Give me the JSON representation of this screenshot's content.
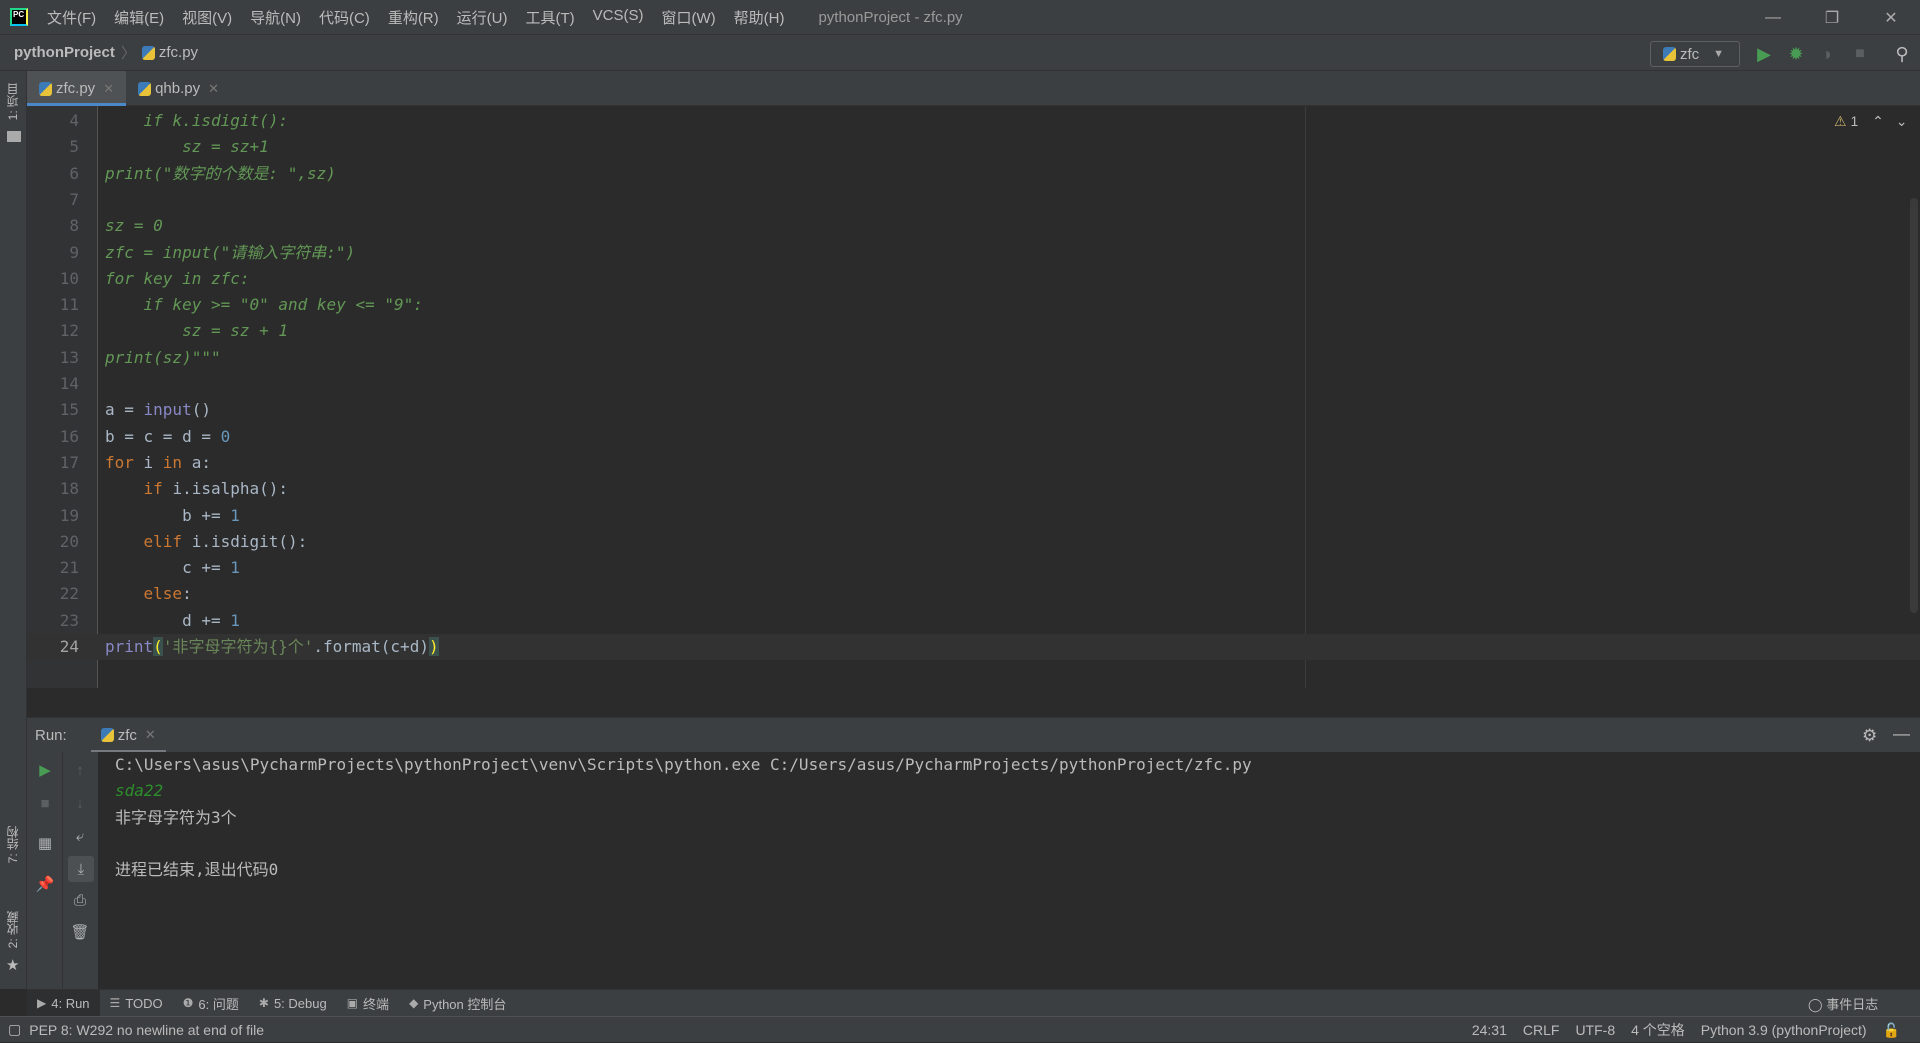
{
  "menu": {
    "items": [
      "文件(F)",
      "编辑(E)",
      "视图(V)",
      "导航(N)",
      "代码(C)",
      "重构(R)",
      "运行(U)",
      "工具(T)",
      "VCS(S)",
      "窗口(W)",
      "帮助(H)"
    ],
    "title": "pythonProject - zfc.py",
    "logo": "PC"
  },
  "nav": {
    "project": "pythonProject",
    "file": "zfc.py",
    "run_config": "zfc"
  },
  "left_strip": {
    "project": "1: 项目",
    "structure": "7: 结构",
    "favorites": "2: 收藏"
  },
  "tabs": [
    {
      "label": "zfc.py",
      "active": true
    },
    {
      "label": "qhb.py",
      "active": false
    }
  ],
  "editor": {
    "warnings": "1",
    "current_line": 24,
    "lines": [
      {
        "n": "4",
        "t": [
          [
            "doc",
            "    if k.isdigit():"
          ]
        ]
      },
      {
        "n": "5",
        "t": [
          [
            "doc",
            "        sz = sz+1"
          ]
        ]
      },
      {
        "n": "6",
        "t": [
          [
            "doc",
            "print(\"数字的个数是: \",sz)"
          ]
        ]
      },
      {
        "n": "7",
        "t": []
      },
      {
        "n": "8",
        "t": [
          [
            "doc",
            "sz = 0"
          ]
        ]
      },
      {
        "n": "9",
        "t": [
          [
            "doc",
            "zfc = input(\"请输入字符串:\")"
          ]
        ]
      },
      {
        "n": "10",
        "t": [
          [
            "doc",
            "for key in zfc:"
          ]
        ]
      },
      {
        "n": "11",
        "t": [
          [
            "doc",
            "    if key >= \"0\" and key <= \"9\":"
          ]
        ]
      },
      {
        "n": "12",
        "t": [
          [
            "doc",
            "        sz = sz + 1"
          ]
        ]
      },
      {
        "n": "13",
        "t": [
          [
            "doc",
            "print(sz)\"\"\""
          ]
        ]
      },
      {
        "n": "14",
        "t": []
      },
      {
        "n": "15",
        "t": [
          [
            "d",
            "a = "
          ],
          [
            "b",
            "input"
          ],
          [
            "d",
            "()"
          ]
        ]
      },
      {
        "n": "16",
        "t": [
          [
            "d",
            "b = c = d = "
          ],
          [
            "n",
            "0"
          ]
        ]
      },
      {
        "n": "17",
        "t": [
          [
            "k",
            "for "
          ],
          [
            "d",
            "i "
          ],
          [
            "k",
            "in "
          ],
          [
            "d",
            "a:"
          ]
        ]
      },
      {
        "n": "18",
        "t": [
          [
            "d",
            "    "
          ],
          [
            "k",
            "if "
          ],
          [
            "d",
            "i.isalpha():"
          ]
        ]
      },
      {
        "n": "19",
        "t": [
          [
            "d",
            "        b += "
          ],
          [
            "n",
            "1"
          ]
        ]
      },
      {
        "n": "20",
        "t": [
          [
            "d",
            "    "
          ],
          [
            "k",
            "elif "
          ],
          [
            "d",
            "i.isdigit():"
          ]
        ]
      },
      {
        "n": "21",
        "t": [
          [
            "d",
            "        c += "
          ],
          [
            "n",
            "1"
          ]
        ]
      },
      {
        "n": "22",
        "t": [
          [
            "d",
            "    "
          ],
          [
            "k",
            "else"
          ],
          [
            "d",
            ":"
          ]
        ]
      },
      {
        "n": "23",
        "t": [
          [
            "d",
            "        d += "
          ],
          [
            "n",
            "1"
          ]
        ]
      },
      {
        "n": "24",
        "t": [
          [
            "b",
            "print"
          ],
          [
            "br",
            "("
          ],
          [
            "s",
            "'非字母字符为{}个'"
          ],
          [
            "d",
            ".format(c+d)"
          ],
          [
            "br",
            ")"
          ]
        ]
      }
    ]
  },
  "run": {
    "label": "Run:",
    "tab": "zfc",
    "output": [
      {
        "type": "cmd",
        "text": "C:\\Users\\asus\\PycharmProjects\\pythonProject\\venv\\Scripts\\python.exe C:/Users/asus/PycharmProjects/pythonProject/zfc.py"
      },
      {
        "type": "in",
        "text": "sda22"
      },
      {
        "type": "out",
        "text": "非字母字符为3个"
      },
      {
        "type": "out",
        "text": ""
      },
      {
        "type": "out",
        "text": "进程已结束,退出代码0"
      }
    ]
  },
  "toolwindows": [
    {
      "label": "4: Run",
      "icon": "▶",
      "active": true
    },
    {
      "label": "TODO",
      "icon": "☰"
    },
    {
      "label": "6: 问题",
      "icon": "❶"
    },
    {
      "label": "5: Debug",
      "icon": "✱"
    },
    {
      "label": "终端",
      "icon": "▣"
    },
    {
      "label": "Python 控制台",
      "icon": "◆"
    }
  ],
  "event_log": "事件日志",
  "status": {
    "message": "PEP 8: W292 no newline at end of file",
    "position": "24:31",
    "line_sep": "CRLF",
    "encoding": "UTF-8",
    "indent": "4 个空格",
    "interpreter": "Python 3.9 (pythonProject)"
  },
  "colors": {
    "accent": "#4a88c7",
    "run_green": "#499c54",
    "keyword": "#cc7832",
    "number": "#6897bb",
    "string": "#6a8759",
    "docstring": "#629755"
  }
}
